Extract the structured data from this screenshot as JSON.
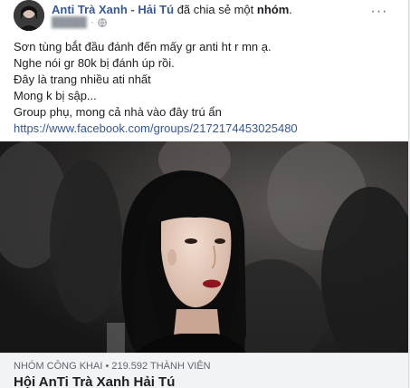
{
  "post": {
    "author": "Anti Trà Xanh - Hải Tú",
    "action_text": "đã chia sẻ một",
    "action_object": "nhóm",
    "more_icon": "ellipsis-icon",
    "privacy_icon": "globe-icon"
  },
  "body": {
    "lines": [
      "Sơn tùng bắt đầu đánh đến mấy gr anti ht r mn ạ.",
      "Nghe nói gr 80k bị đánh úp rồi.",
      "Đây là trang nhiều ati nhất",
      "Mong k bị sập...",
      "Group phụ, mong cả nhà vào đây trú ẩn"
    ],
    "link": "https://www.facebook.com/groups/2172174453025480"
  },
  "shared_group": {
    "privacy": "NHÓM CÔNG KHAI",
    "members": "219.592 THÀNH VIÊN",
    "separator": "•",
    "name": "Hội AnTi Trà Xanh Hải Tú"
  },
  "colors": {
    "link": "#385898",
    "text": "#1c1e21",
    "muted": "#90949c",
    "footer_bg": "#f2f3f5"
  }
}
